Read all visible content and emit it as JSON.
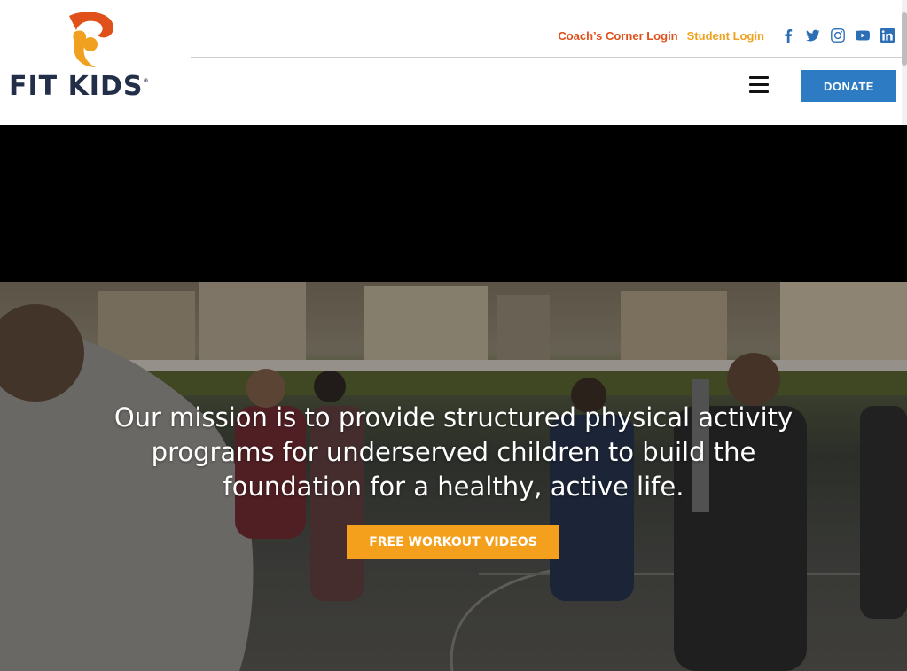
{
  "header": {
    "logo_text": "FIT KIDS",
    "logo_reg": "®",
    "coach_login": "Coach’s Corner Login",
    "student_login": "Student Login",
    "social": [
      "facebook-icon",
      "twitter-icon",
      "instagram-icon",
      "youtube-icon",
      "linkedin-icon"
    ],
    "donate_label": "DONATE"
  },
  "hero": {
    "mission_text": "Our mission is to provide structured physical activity programs for underserved children to build the foundation for a healthy, active life.",
    "cta_label": "FREE WORKOUT VIDEOS"
  },
  "colors": {
    "brand_blue": "#2d7bc2",
    "brand_orange": "#e0501b",
    "brand_yellow": "#f0a11f",
    "cta_orange": "#f4a01c",
    "logo_navy": "#232f48"
  }
}
